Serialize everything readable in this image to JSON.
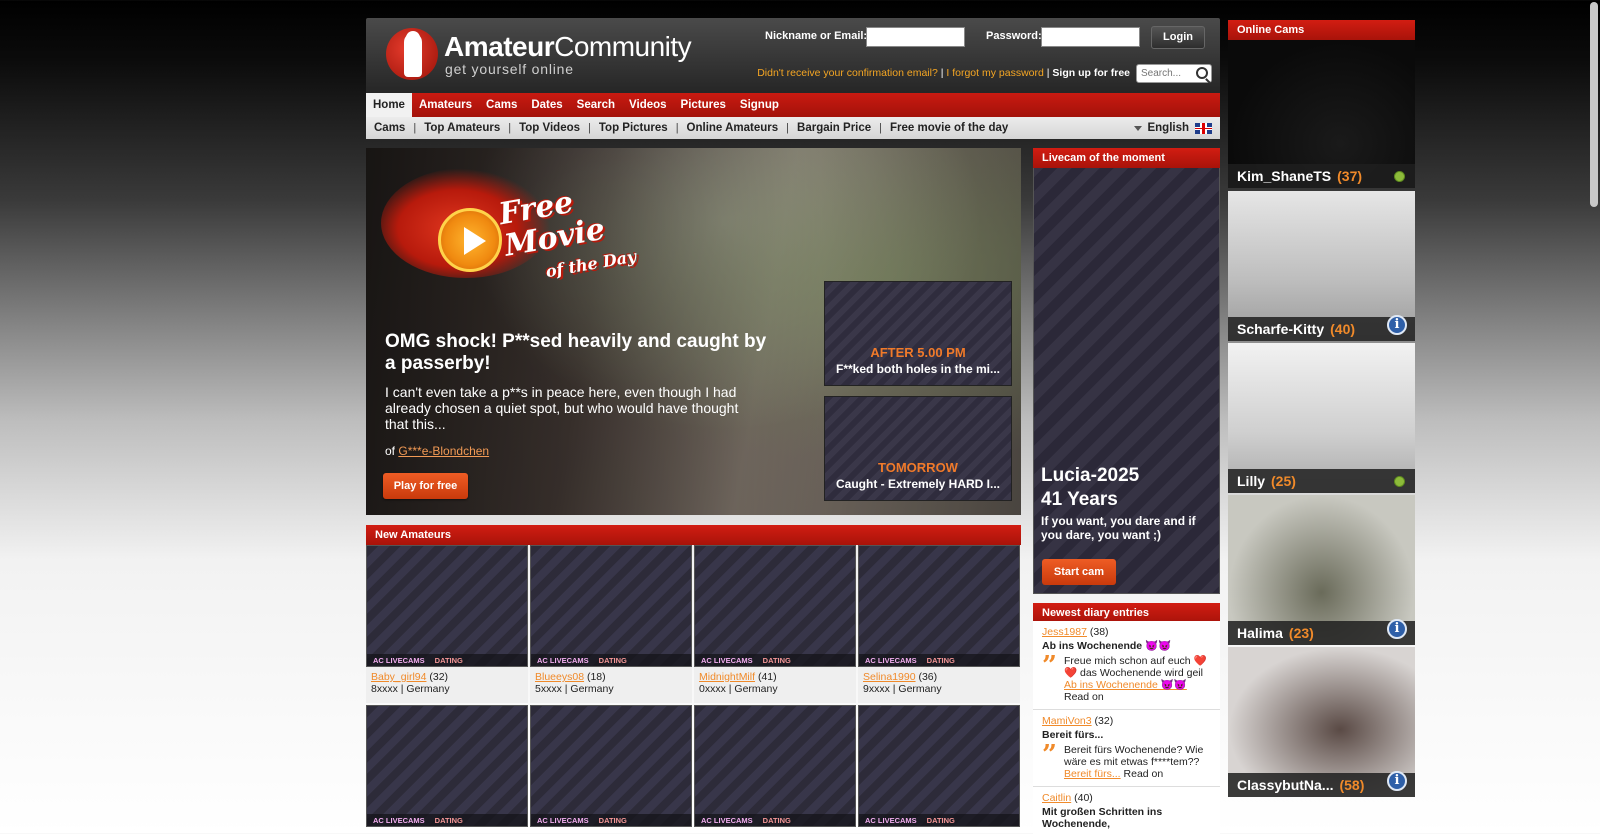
{
  "header": {
    "logo_bold": "Amateur",
    "logo_light": "Community",
    "tagline": "get yourself online",
    "login": {
      "nickname_label": "Nickname or Email:",
      "nickname_value": "",
      "password_label": "Password:",
      "password_value": "",
      "login_button": "Login"
    },
    "links": {
      "confirmation": "Didn't receive your confirmation email?",
      "forgot": "I forgot my password",
      "signup": "Sign up for free"
    },
    "search_placeholder": "Search..."
  },
  "nav_main": [
    "Home",
    "Amateurs",
    "Cams",
    "Dates",
    "Search",
    "Videos",
    "Pictures",
    "Signup"
  ],
  "nav_sub": [
    "Cams",
    "Top Amateurs",
    "Top Videos",
    "Top Pictures",
    "Online Amateurs",
    "Bargain Price",
    "Free movie of the day"
  ],
  "language": "English",
  "hero": {
    "promo_line1": "Free",
    "promo_line2": "Movie",
    "promo_line3": "of the Day",
    "title": "OMG shock! P**sed heavily and caught by a passerby!",
    "description": "I can't even take a p**s in peace here, even though I had already chosen a quiet spot, but who would have thought that this...",
    "author_prefix": "of",
    "author": "G***e-Blondchen",
    "play_button": "Play for free",
    "upcoming": [
      {
        "when": "AFTER 5.00 PM",
        "what": "F**ked both holes in the mi..."
      },
      {
        "when": "TOMORROW",
        "what": "Caught - Extremely HARD I..."
      }
    ]
  },
  "new_amateurs": {
    "heading": "New Amateurs",
    "tag_cams": "AC LIVECAMS",
    "tag_dating": "DATING",
    "items": [
      {
        "name": "Baby_girl94",
        "age": "(32)",
        "location": "8xxxx | Germany"
      },
      {
        "name": "Blueeys08",
        "age": "(18)",
        "location": "5xxxx | Germany"
      },
      {
        "name": "MidnightMilf",
        "age": "(41)",
        "location": "0xxxx | Germany"
      },
      {
        "name": "Selina1990",
        "age": "(36)",
        "location": "9xxxx | Germany"
      }
    ]
  },
  "livecam": {
    "heading": "Livecam of the moment",
    "name": "Lucia-2025",
    "age": "41 Years",
    "quote": "If you want, you dare and if you dare, you want ;)",
    "button": "Start cam"
  },
  "diary": {
    "heading": "Newest diary entries",
    "read_on": "Read on",
    "entries": [
      {
        "user": "Jess1987",
        "age": "(38)",
        "title": "Ab ins Wochenende 😈😈",
        "body": "Freue mich schon auf euch ❤️ ❤️ das Wochenende wird geil",
        "link": "Ab ins Wochenende 😈😈"
      },
      {
        "user": "MamiVon3",
        "age": "(32)",
        "title": "Bereit fürs...",
        "body": "Bereit fürs Wochenende? Wie wäre es mit etwas f****tem??",
        "link": "Bereit fürs..."
      },
      {
        "user": "Caitlin",
        "age": "(40)",
        "title": "Mit großen Schritten ins Wochenende,",
        "body": "",
        "link": ""
      }
    ]
  },
  "online_cams": {
    "heading": "Online Cams",
    "items": [
      {
        "name": "Kim_ShaneTS",
        "age": "(37)",
        "status": "online"
      },
      {
        "name": "Scharfe-Kitty",
        "age": "(40)",
        "status": "info"
      },
      {
        "name": "Lilly",
        "age": "(25)",
        "status": "online"
      },
      {
        "name": "Halima",
        "age": "(23)",
        "status": "info"
      },
      {
        "name": "ClassybutNa...",
        "age": "(58)",
        "status": "info"
      }
    ]
  },
  "colors": {
    "brand_red": "#c91a11",
    "accent_orange": "#f08a2a",
    "online_green": "#8dbb3a"
  }
}
